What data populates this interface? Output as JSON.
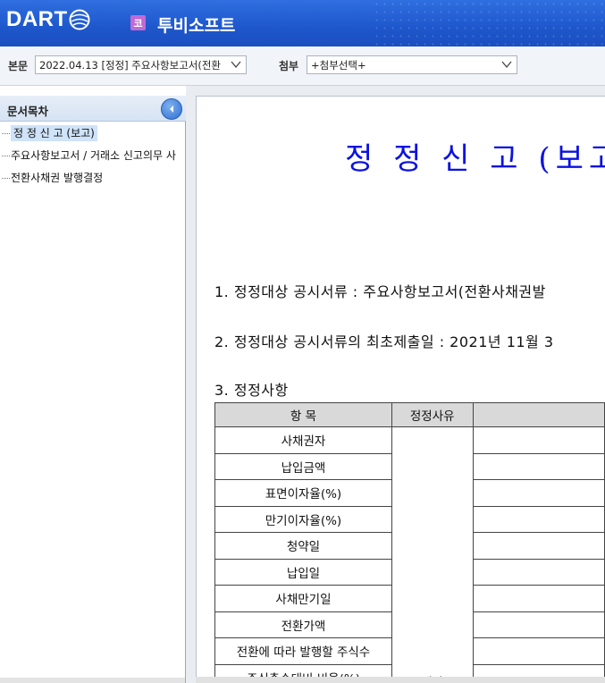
{
  "header": {
    "logo_text": "DART",
    "company_badge": "코",
    "company_name": "투비소프트"
  },
  "toolbar": {
    "body_label": "본문",
    "body_select_value": "2022.04.13  [정정] 주요사항보고서(전환",
    "attach_label": "첨부",
    "attach_select_value": "+첨부선택+"
  },
  "sidebar": {
    "title": "문서목차",
    "items": [
      {
        "label": "정 정 신 고 (보고)",
        "active": true
      },
      {
        "label": "주요사항보고서 / 거래소 신고의무 사"
      },
      {
        "label": "전환사채권 발행결정"
      }
    ]
  },
  "document": {
    "title": "정 정 신 고 (보고",
    "para1": "1. 정정대상 공시서류 : 주요사항보고서(전환사채권발",
    "para2": "2. 정정대상 공시서류의 최초제출일 : 2021년 11월 3",
    "para3": "3. 정정사항",
    "table": {
      "headers": [
        "항 목",
        "정정사유",
        ""
      ],
      "rows": [
        "사채권자",
        "납입금액",
        "표면이자율(%)",
        "만기이자율(%)",
        "청약일",
        "납입일",
        "사채만기일",
        "전환가액",
        "전환에 따라 발행할 주식수",
        "주식총수대비 비율(%)"
      ],
      "reason": "계약"
    }
  }
}
